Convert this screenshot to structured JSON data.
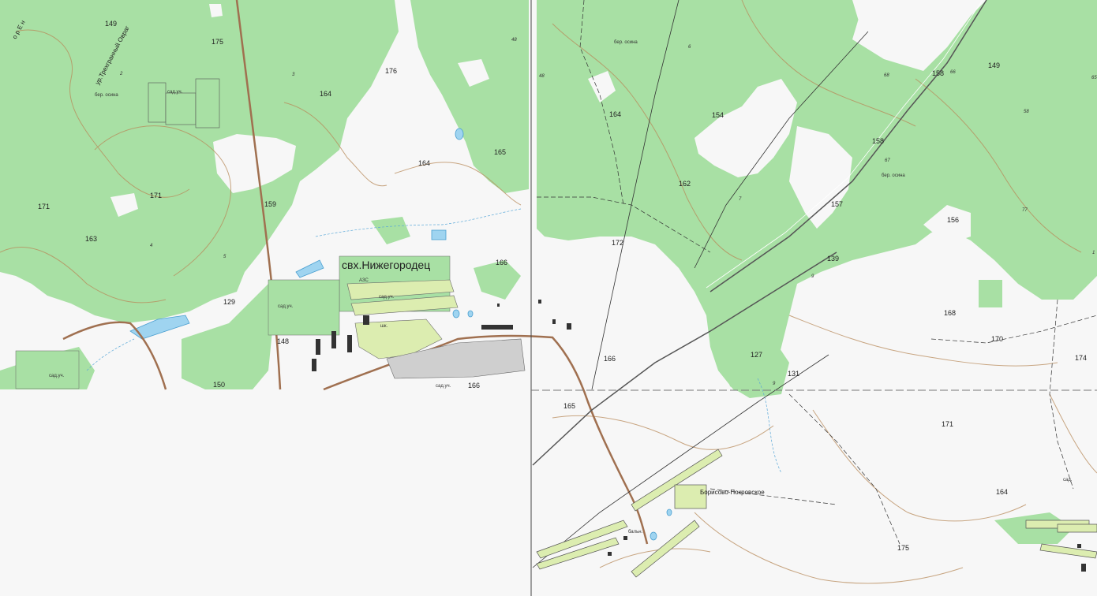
{
  "colors": {
    "forest": "#a8e0a4",
    "open": "#f7f7f7",
    "contour": "#b88a5a",
    "water": "#9fd4f0",
    "road": "#a07050",
    "grid": "#444444",
    "settlement": "#dcedb0"
  },
  "places": {
    "nizhegorodets": "свх.Нижегородец",
    "borisovo": "Борисово-Покровское",
    "ravine": "ур.Трехгранный Овраг",
    "ravine_top": "о р Е н",
    "orchard_1": "сад.уч.",
    "orchard_2": "сад.уч.",
    "orchard_3": "сад.уч.",
    "orchard_4": "сад.уч.",
    "orchard_5": "сад.уч.",
    "azs": "АЗС",
    "hospital": "бальн.",
    "school": "шк.",
    "sad": "сад.",
    "tree_1": "бер. осина",
    "tree_2": "бер. осина",
    "tree_3": "бер. осина"
  },
  "elevations": {
    "e149a": "149",
    "e175a": "175",
    "e164a": "164",
    "e176": "176",
    "e171a": "171",
    "e171b": "171",
    "e163": "163",
    "e159": "159",
    "e164b": "164",
    "e165a": "165",
    "e166a": "166",
    "e129": "129",
    "e148": "148",
    "e150": "150",
    "e166b": "166",
    "e164c": "164",
    "e154": "154",
    "e162": "162",
    "e172": "172",
    "e166c": "166",
    "e158a": "158",
    "e149b": "149",
    "e158b": "158",
    "e157": "157",
    "e156": "156",
    "e139": "139",
    "e168": "168",
    "e170": "170",
    "e174": "174",
    "e127": "127",
    "e131": "131",
    "e165b": "165",
    "e171c": "171",
    "e164d": "164",
    "e175b": "175"
  },
  "quarters": {
    "q48a": "48",
    "q48b": "48",
    "q3": "3",
    "q2": "2",
    "q4": "4",
    "q5": "5",
    "q6": "6",
    "q7": "7",
    "q9a": "9",
    "q9b": "9",
    "q68": "68",
    "q66": "66",
    "q58": "58",
    "q67": "67",
    "q77": "77",
    "q65": "65",
    "q1": "1"
  }
}
